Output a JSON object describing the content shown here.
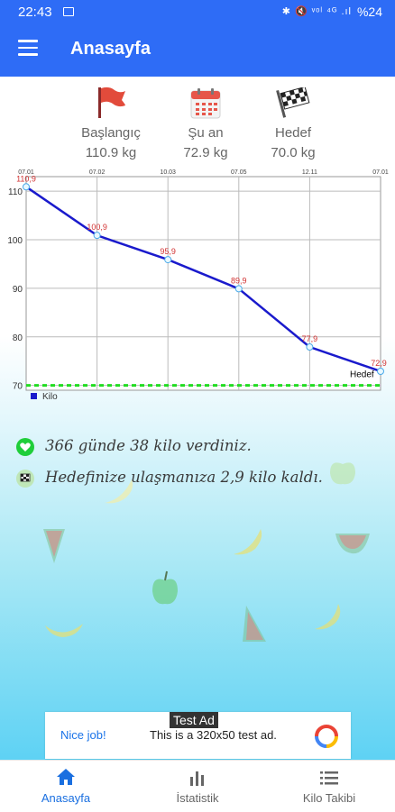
{
  "status_bar": {
    "time": "22:43",
    "icons": "✱ 🔇 ᵛᵒˡ ⁴ᴳ .ıl",
    "battery": "%24"
  },
  "app_bar": {
    "title": "Anasayfa"
  },
  "stats": [
    {
      "icon": "flag-icon",
      "label": "Başlangıç",
      "value": "110.9 kg"
    },
    {
      "icon": "calendar-icon",
      "label": "Şu an",
      "value": "72.9 kg"
    },
    {
      "icon": "checkered-flag-icon",
      "label": "Hedef",
      "value": "70.0 kg"
    }
  ],
  "chart_data": {
    "type": "line",
    "x_tick_labels": [
      "07.01",
      "07.02",
      "10.03",
      "07.05",
      "12.11",
      "07.01"
    ],
    "series": [
      {
        "name": "Kilo",
        "values": [
          110.9,
          100.9,
          95.9,
          89.9,
          77.9,
          72.9
        ],
        "point_labels": [
          "110,9",
          "100,9",
          "95,9",
          "89,9",
          "77,9",
          "72,9"
        ],
        "color": "#1a1acc"
      }
    ],
    "target_line": {
      "label": "Hedef",
      "value": 70,
      "color": "#22dd22"
    },
    "y_ticks": [
      70,
      80,
      90,
      100,
      110
    ],
    "ylim": [
      69,
      113
    ],
    "grid": true,
    "legend": "bottom-left"
  },
  "messages": [
    "366 günde 38 kilo verdiniz.",
    "Hedefinize ulaşmanıza 2,9 kilo kaldı."
  ],
  "ad": {
    "nice": "Nice job!",
    "text": "This is a 320x50 test ad.",
    "tag": "Test Ad"
  },
  "bottom_nav": [
    {
      "icon": "home-icon",
      "label": "Anasayfa",
      "active": true
    },
    {
      "icon": "bar-chart-icon",
      "label": "İstatistik",
      "active": false
    },
    {
      "icon": "list-icon",
      "label": "Kilo Takibi",
      "active": false
    }
  ],
  "colors": {
    "primary": "#2e6cf6",
    "accent_nav": "#1a6fe0",
    "chart_line": "#1a1acc",
    "target": "#22dd22",
    "point_label": "#d23232"
  }
}
